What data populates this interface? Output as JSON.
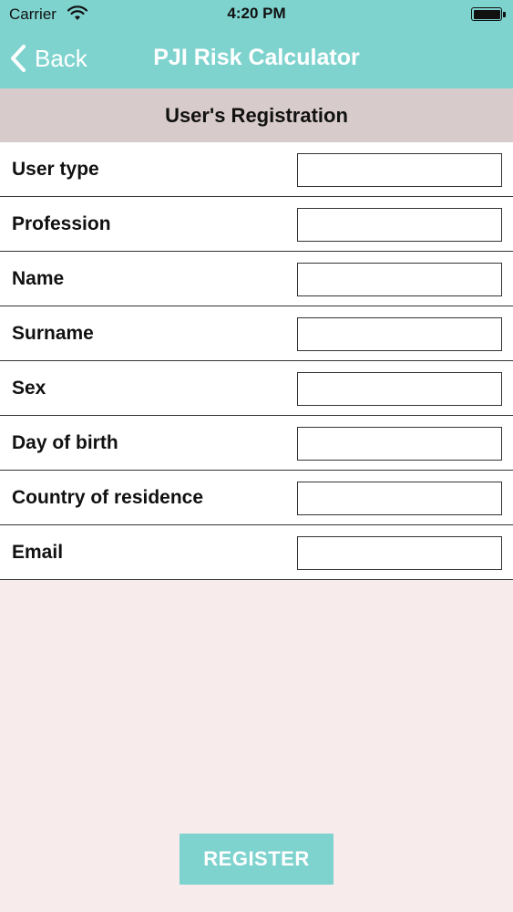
{
  "status_bar": {
    "carrier": "Carrier",
    "time": "4:20 PM",
    "wifi_icon": "wifi-icon",
    "battery_icon": "battery-icon"
  },
  "nav": {
    "back_label": "Back",
    "back_icon": "chevron-left-icon",
    "title": "PJI Risk Calculator"
  },
  "section": {
    "title": "User's Registration"
  },
  "form": {
    "fields": [
      {
        "label": "User type",
        "value": ""
      },
      {
        "label": "Profession",
        "value": ""
      },
      {
        "label": "Name",
        "value": ""
      },
      {
        "label": "Surname",
        "value": ""
      },
      {
        "label": "Sex",
        "value": ""
      },
      {
        "label": "Day of birth",
        "value": ""
      },
      {
        "label": "Country of residence",
        "value": ""
      },
      {
        "label": "Email",
        "value": ""
      }
    ]
  },
  "actions": {
    "register_label": "REGISTER"
  },
  "colors": {
    "accent": "#7fd3cf",
    "section_header_bg": "#d8cbcb",
    "page_bg": "#f8ebeb"
  }
}
